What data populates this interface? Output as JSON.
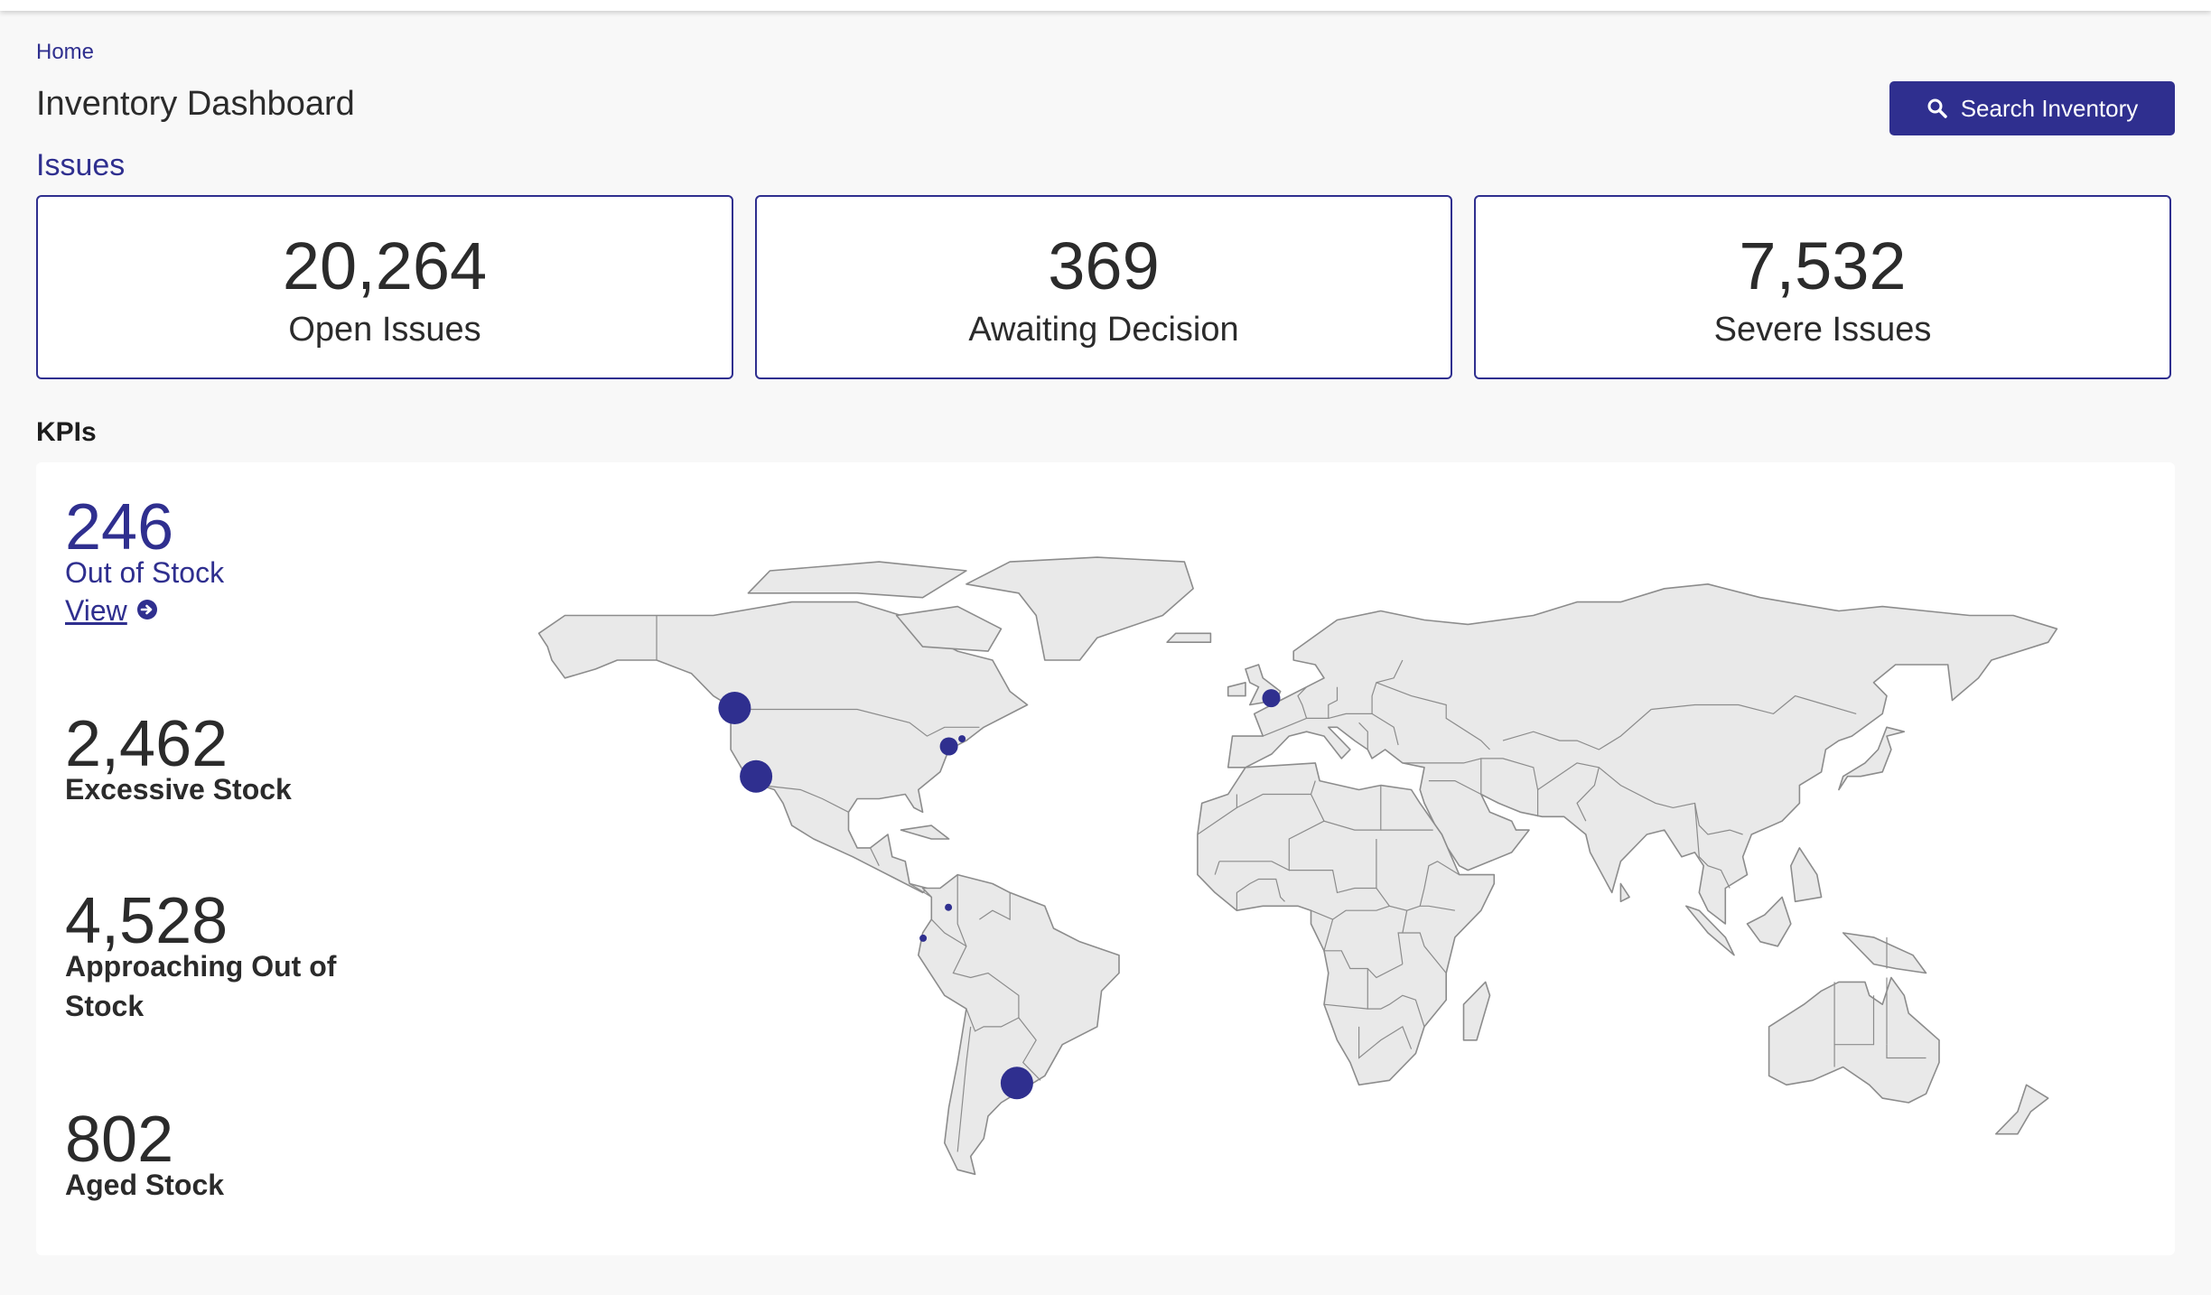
{
  "breadcrumb": {
    "home": "Home"
  },
  "header": {
    "title": "Inventory Dashboard",
    "search_button_label": "Search Inventory",
    "search_icon": "search-icon"
  },
  "issues": {
    "section_label": "Issues",
    "cards": [
      {
        "value": "20,264",
        "label": "Open Issues"
      },
      {
        "value": "369",
        "label": "Awaiting Decision"
      },
      {
        "value": "7,532",
        "label": "Severe Issues"
      }
    ]
  },
  "kpis": {
    "section_label": "KPIs",
    "cards": [
      {
        "value": "246",
        "label": "Out of Stock",
        "link_label": "View",
        "link_icon": "arrow-circle-right-icon",
        "selected": true
      },
      {
        "value": "2,462",
        "label": "Excessive Stock"
      },
      {
        "value": "4,528",
        "label": "Approaching Out of Stock"
      },
      {
        "value": "802",
        "label": "Aged Stock"
      }
    ]
  },
  "map": {
    "marker_color": "#2f2f8f",
    "land_color": "#e9e9e9",
    "border_color": "#8c8c8c",
    "markers": [
      {
        "place": "Vancouver",
        "lat": 49.3,
        "lon": -123.1,
        "size": "large"
      },
      {
        "place": "Los Angeles",
        "lat": 34.0,
        "lon": -118.2,
        "size": "large"
      },
      {
        "place": "New York",
        "lat": 40.7,
        "lon": -74.0,
        "size": "medium"
      },
      {
        "place": "Boston",
        "lat": 42.4,
        "lon": -71.0,
        "size": "tiny"
      },
      {
        "place": "London",
        "lat": 51.5,
        "lon": -0.1,
        "size": "medium"
      },
      {
        "place": "Bogota",
        "lat": 4.7,
        "lon": -74.1,
        "size": "tiny"
      },
      {
        "place": "Guayaquil",
        "lat": -2.2,
        "lon": -79.9,
        "size": "tiny"
      },
      {
        "place": "Buenos Aires",
        "lat": -34.6,
        "lon": -58.4,
        "size": "large"
      }
    ]
  },
  "colors": {
    "accent": "#2f2f8f",
    "background": "#f8f8f8",
    "card": "#ffffff",
    "text": "#2b2b2b"
  }
}
